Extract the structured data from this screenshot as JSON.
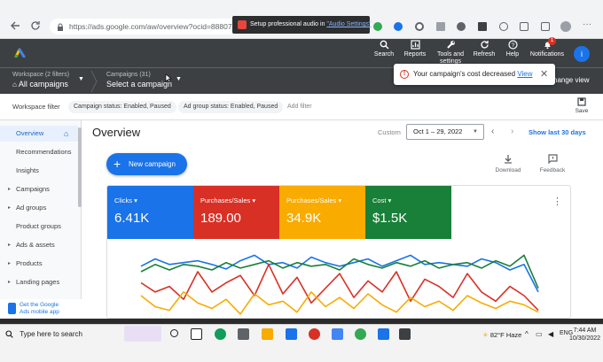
{
  "browser": {
    "url": "https://ads.google.com/aw/overview?ocid=88807214&u",
    "audio_text": "Setup professional audio in",
    "audio_link": "\"Audio Settings\""
  },
  "header": {
    "buttons": [
      {
        "label": "Search",
        "icon": "search-icon"
      },
      {
        "label": "Reports",
        "icon": "reports-icon"
      },
      {
        "label": "Tools and settings",
        "icon": "wrench-icon"
      },
      {
        "label": "Refresh",
        "icon": "refresh-icon"
      },
      {
        "label": "Help",
        "icon": "help-icon"
      },
      {
        "label": "Notifications",
        "icon": "bell-icon"
      }
    ],
    "notification_count": "1",
    "avatar_letter": "i"
  },
  "subheader": {
    "workspace_small": "Workspace (2 filters)",
    "workspace_big": "All campaigns",
    "campaigns_small": "Campaigns (31)",
    "campaigns_big": "Select a campaign",
    "change_view": "hange view"
  },
  "toast": {
    "text": "Your campaign's cost decreased",
    "link": "View"
  },
  "filters": {
    "label": "Workspace filter",
    "chips": [
      "Campaign status: Enabled, Paused",
      "Ad group status: Enabled, Paused"
    ],
    "add": "Add filter",
    "save": "Save"
  },
  "sidebar": {
    "items": [
      {
        "label": "Overview",
        "active": true,
        "caret": false
      },
      {
        "label": "Recommendations",
        "caret": false
      },
      {
        "label": "Insights",
        "caret": false
      },
      {
        "label": "Campaigns",
        "caret": true
      },
      {
        "label": "Ad groups",
        "caret": true
      },
      {
        "label": "Product groups",
        "caret": false
      },
      {
        "label": "Ads & assets",
        "caret": true
      },
      {
        "label": "Products",
        "caret": true
      },
      {
        "label": "Landing pages",
        "caret": true
      }
    ],
    "promo_line1": "Get the Google",
    "promo_line2": "Ads mobile app"
  },
  "main": {
    "title": "Overview",
    "custom_label": "Custom",
    "date_range": "Oct 1 – 29, 2022",
    "show_last": "Show last 30 days",
    "new_campaign": "New campaign",
    "download": "Download",
    "feedback": "Feedback"
  },
  "colors": {
    "blue": "#1a73e8",
    "red": "#d93025",
    "yellow": "#f9ab00",
    "green": "#188038"
  },
  "chart_data": {
    "type": "line",
    "title": "",
    "xlabel": "",
    "ylabel": "",
    "x": [
      1,
      2,
      3,
      4,
      5,
      6,
      7,
      8,
      9,
      10,
      11,
      12,
      13,
      14,
      15,
      16,
      17,
      18,
      19,
      20,
      21,
      22,
      23,
      24,
      25,
      26,
      27,
      28,
      29
    ],
    "series": [
      {
        "name": "Clicks",
        "value_label": "6.41K",
        "color": "#1a73e8",
        "values": [
          58,
          66,
          60,
          62,
          64,
          60,
          55,
          64,
          70,
          60,
          62,
          56,
          68,
          62,
          58,
          62,
          66,
          58,
          64,
          70,
          60,
          62,
          60,
          58,
          66,
          62,
          54,
          60,
          30
        ]
      },
      {
        "name": "Purchases/Sales",
        "value_label": "189.00",
        "color": "#d93025",
        "values": [
          40,
          30,
          36,
          22,
          52,
          30,
          40,
          48,
          26,
          60,
          28,
          46,
          18,
          34,
          50,
          24,
          42,
          30,
          52,
          20,
          44,
          36,
          24,
          50,
          30,
          20,
          36,
          26,
          10
        ]
      },
      {
        "name": "Purchases/Sales",
        "value_label": "34.9K",
        "color": "#f9ab00",
        "values": [
          26,
          14,
          10,
          30,
          18,
          12,
          22,
          6,
          28,
          16,
          20,
          8,
          30,
          14,
          24,
          12,
          28,
          16,
          8,
          24,
          14,
          20,
          10,
          26,
          18,
          12,
          20,
          16,
          8
        ]
      },
      {
        "name": "Cost",
        "value_label": "$1.5K",
        "color": "#188038",
        "values": [
          52,
          60,
          54,
          60,
          58,
          54,
          62,
          56,
          60,
          64,
          56,
          62,
          58,
          60,
          54,
          66,
          60,
          56,
          62,
          58,
          64,
          56,
          60,
          62,
          56,
          64,
          58,
          70,
          34
        ]
      }
    ]
  },
  "taskbar": {
    "search": "Type here to search",
    "weather": "82°F  Haze",
    "time": "7:44 AM",
    "date": "10/30/2022"
  }
}
